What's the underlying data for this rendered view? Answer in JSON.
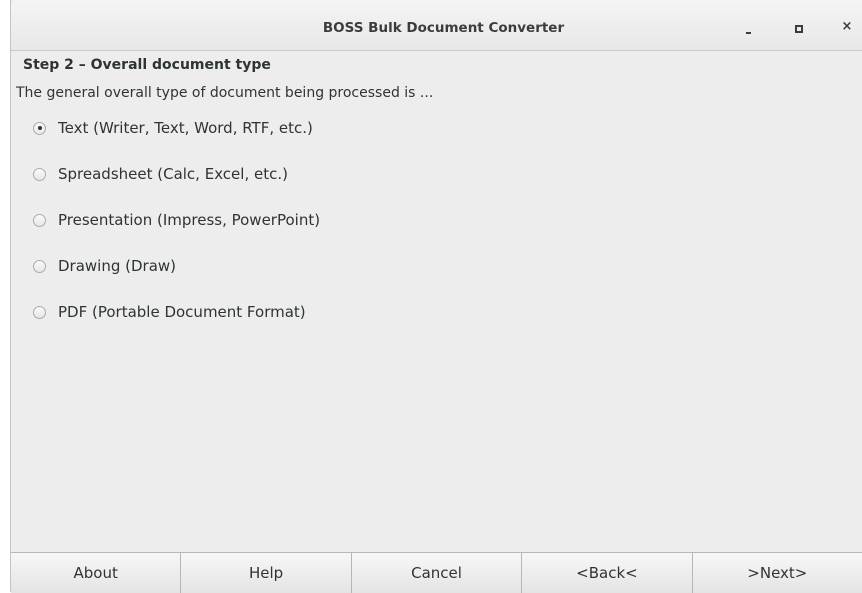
{
  "window": {
    "title": "BOSS Bulk Document Converter",
    "controls": {
      "minimize_icon": "minimize-icon",
      "maximize_icon": "maximize-icon",
      "close_glyph": "×"
    }
  },
  "step": {
    "heading": "Step 2 – Overall document type",
    "instruction": "The general overall type of document being processed is ..."
  },
  "options": [
    {
      "label": "Text (Writer, Text, Word, RTF, etc.)",
      "checked": true
    },
    {
      "label": "Spreadsheet (Calc, Excel, etc.)",
      "checked": false
    },
    {
      "label": "Presentation (Impress, PowerPoint)",
      "checked": false
    },
    {
      "label": "Drawing (Draw)",
      "checked": false
    },
    {
      "label": "PDF (Portable Document Format)",
      "checked": false
    }
  ],
  "buttons": {
    "about": "About",
    "help": "Help",
    "cancel": "Cancel",
    "back": "<Back<",
    "next": ">Next>"
  }
}
